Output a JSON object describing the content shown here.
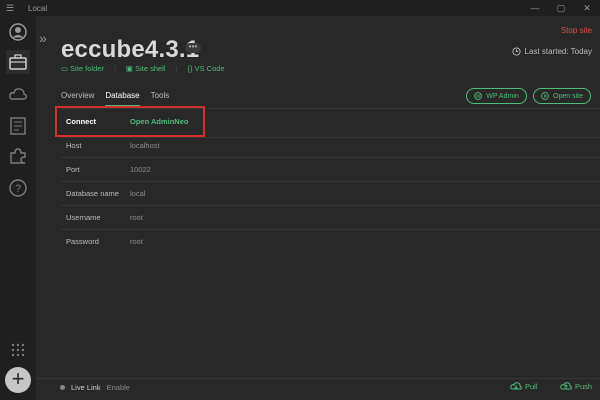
{
  "window": {
    "title": "Local",
    "menu_glyph": "☰",
    "minimize": "—",
    "maximize": "▢",
    "close": "✕"
  },
  "site": {
    "name": "eccube4.3.1",
    "more": "•••",
    "stop_site": "Stop site",
    "last_started": "Last started: Today"
  },
  "links": {
    "site_folder": "Site folder",
    "site_shell": "Site shell",
    "vs_code": "VS Code"
  },
  "tabs": [
    "Overview",
    "Database",
    "Tools"
  ],
  "actions": {
    "wp_admin": "WP Admin",
    "open_site": "Open site"
  },
  "database": {
    "connect_label": "Connect",
    "connect_value": "Open AdminNeo",
    "host_label": "Host",
    "host_value": "localhost",
    "port_label": "Port",
    "port_value": "10022",
    "dbname_label": "Database name",
    "dbname_value": "local",
    "username_label": "Username",
    "username_value": "root",
    "password_label": "Password",
    "password_value": "root"
  },
  "footer": {
    "live_link": "Live Link",
    "enable": "Enable",
    "pull": "Pull",
    "push": "Push"
  },
  "colors": {
    "accent": "#51bb7b",
    "danger": "#d9534f",
    "highlight": "#d32f2f"
  },
  "icons": [
    "hamburger-menu-icon",
    "user-avatar-icon",
    "sites-briefcase-icon",
    "cloud-connect-icon",
    "blueprints-icon",
    "addons-puzzle-icon",
    "help-icon",
    "grid-dots-icon",
    "add-site-icon",
    "collapse-sidebar-icon",
    "more-options-icon",
    "clock-icon",
    "folder-icon",
    "terminal-icon",
    "code-braces-icon",
    "wordpress-icon",
    "open-site-icon",
    "pull-icon",
    "push-icon"
  ]
}
